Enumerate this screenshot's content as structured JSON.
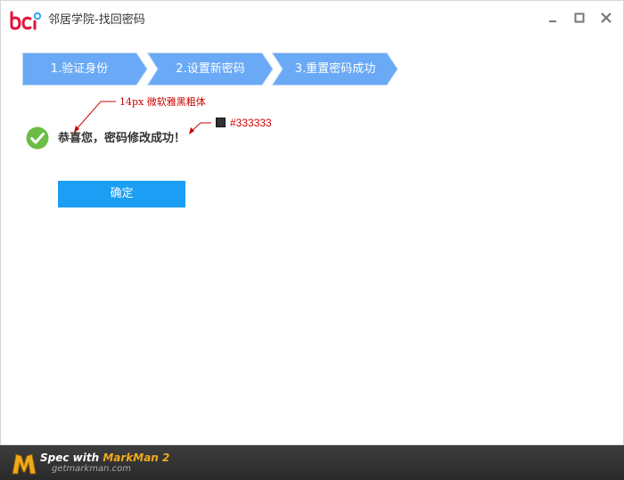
{
  "window": {
    "title": "邻居学院-找回密码",
    "brand_color": "#e0153b"
  },
  "steps": [
    {
      "label": "1.验证身份"
    },
    {
      "label": "2.设置新密码"
    },
    {
      "label": "3.重置密码成功"
    }
  ],
  "step_colors": {
    "fill": "#6aa9f5",
    "border": "#b8d5fb"
  },
  "content": {
    "success_message": "恭喜您，密码修改成功！",
    "confirm_button": "确定",
    "button_color": "#1c9ef5",
    "success_icon_color": "#6cbd45"
  },
  "annotations": {
    "font_note": "14px 微软雅黑粗体",
    "color_note": "#333333",
    "color_value": "#333333"
  },
  "footer": {
    "spec_prefix": "Spec with ",
    "brand": "MarkMan 2",
    "url": "getmarkman.com"
  }
}
